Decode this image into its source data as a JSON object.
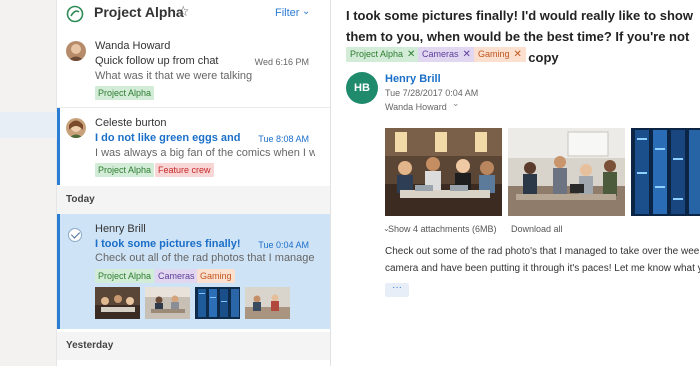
{
  "list": {
    "folder_name": "Project Alpha",
    "star_glyph": "☆",
    "filter_label": "Filter",
    "filter_chevron": "⌄"
  },
  "messages": [
    {
      "sender": "Wanda Howard",
      "subject": "Quick follow up from chat",
      "time": "Wed 6:16 PM",
      "preview": "What was it that we were talking",
      "tags": [
        "Project Alpha"
      ],
      "unread": false
    },
    {
      "sender": "Celeste burton",
      "subject": "I do not like green eggs and",
      "time": "Tue 8:08 AM",
      "preview": "I was always a big fan of the comics when I was",
      "tags": [
        "Project Alpha",
        "Feature crew"
      ],
      "unread": true
    },
    {
      "sender": "Henry Brill",
      "subject": "I took some pictures finally!",
      "time": "Tue 0:04 AM",
      "preview": "Check out all of the rad photos that I managed",
      "tags": [
        "Project Alpha",
        "Cameras",
        "Gaming"
      ],
      "unread": true,
      "selected": true
    }
  ],
  "groups": {
    "today": "Today",
    "yesterday": "Yesterday"
  },
  "reading": {
    "subject": "I took some pictures finally! I'd would really like to show them to you, when would be the best time? If you're not available then I've attached a copy",
    "tags": [
      "Project Alpha",
      "Cameras",
      "Gaming"
    ],
    "tag_remove_glyph": "✕",
    "sender_initials": "HB",
    "sender_name": "Henry Brill",
    "date": "Tue 7/28/2017 0:04 AM",
    "to": "Wanda Howard",
    "to_chevron": "⌄",
    "attachments_label": "Show 4 attachments (6MB)",
    "attachments_chevron": "⌄",
    "download_all": "Download all",
    "body_line1": "Check out some of the rad photo's that I managed to take over the weekend. I got a new",
    "body_line2": "camera and have been putting it through it's paces! Let me know what you think",
    "more_glyph": "···"
  },
  "colors": {
    "accent": "#2b7cd3",
    "selected_bg": "#cfe3f6",
    "avatar_bg": "#1f8a6c"
  }
}
